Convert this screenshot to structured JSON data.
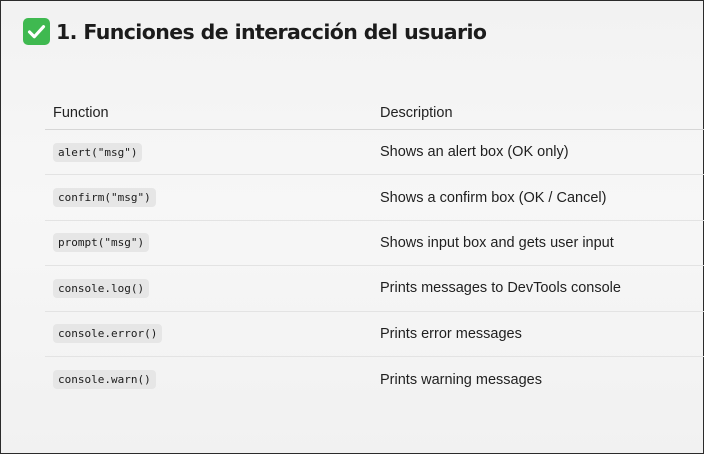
{
  "heading": {
    "icon": "check-mark-icon",
    "text": "1. Funciones de interacción del usuario"
  },
  "table": {
    "headers": [
      "Function",
      "Description"
    ],
    "rows": [
      {
        "function": "alert(\"msg\")",
        "description": "Shows an alert box (OK only)"
      },
      {
        "function": "confirm(\"msg\")",
        "description": "Shows a confirm box (OK / Cancel)"
      },
      {
        "function": "prompt(\"msg\")",
        "description": "Shows input box and gets user input"
      },
      {
        "function": "console.log()",
        "description": "Prints messages to DevTools console"
      },
      {
        "function": "console.error()",
        "description": "Prints error messages"
      },
      {
        "function": "console.warn()",
        "description": "Prints warning messages"
      }
    ]
  },
  "colors": {
    "check_icon_bg": "#3fb950",
    "code_bg": "#e6e6e6"
  }
}
